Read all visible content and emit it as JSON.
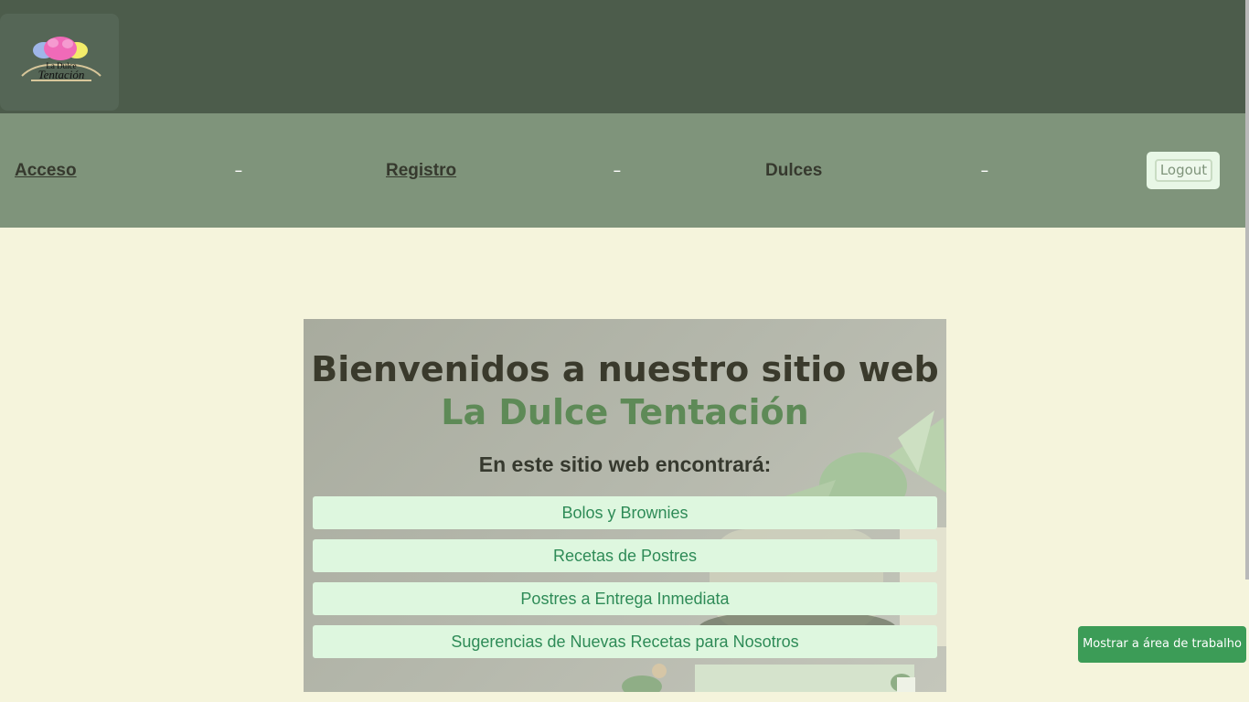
{
  "logo": {
    "text_line1": "La Dulce",
    "text_line2": "Tentación",
    "icon": "cupcake-logo-icon"
  },
  "nav": {
    "items": [
      {
        "label": "Acceso",
        "link": true
      },
      {
        "label": "Registro",
        "link": true
      },
      {
        "label": "Dulces",
        "link": false
      }
    ],
    "separator": "–",
    "logout_label": "Logout"
  },
  "hero": {
    "title_part1": "Bienvenidos a nuestro sitio web ",
    "title_brand": "La Dulce Tentación",
    "subtitle": "En este sitio web encontrará:",
    "buttons": [
      "Bolos y Brownies",
      "Recetas de Postres",
      "Postres a Entrega Inmediata",
      "Sugerencias de Nuevas Recetas para Nosotros"
    ]
  },
  "toast": {
    "label": "Mostrar a área de trabalho"
  },
  "colors": {
    "topbar": "#4c5c4b",
    "navbar": "#7f947b",
    "page_bg": "#f5f4dc",
    "brand_green": "#5e8a57",
    "button_bg": "#def7df",
    "button_text": "#2e8b57",
    "toast_bg": "#3c9c57"
  }
}
